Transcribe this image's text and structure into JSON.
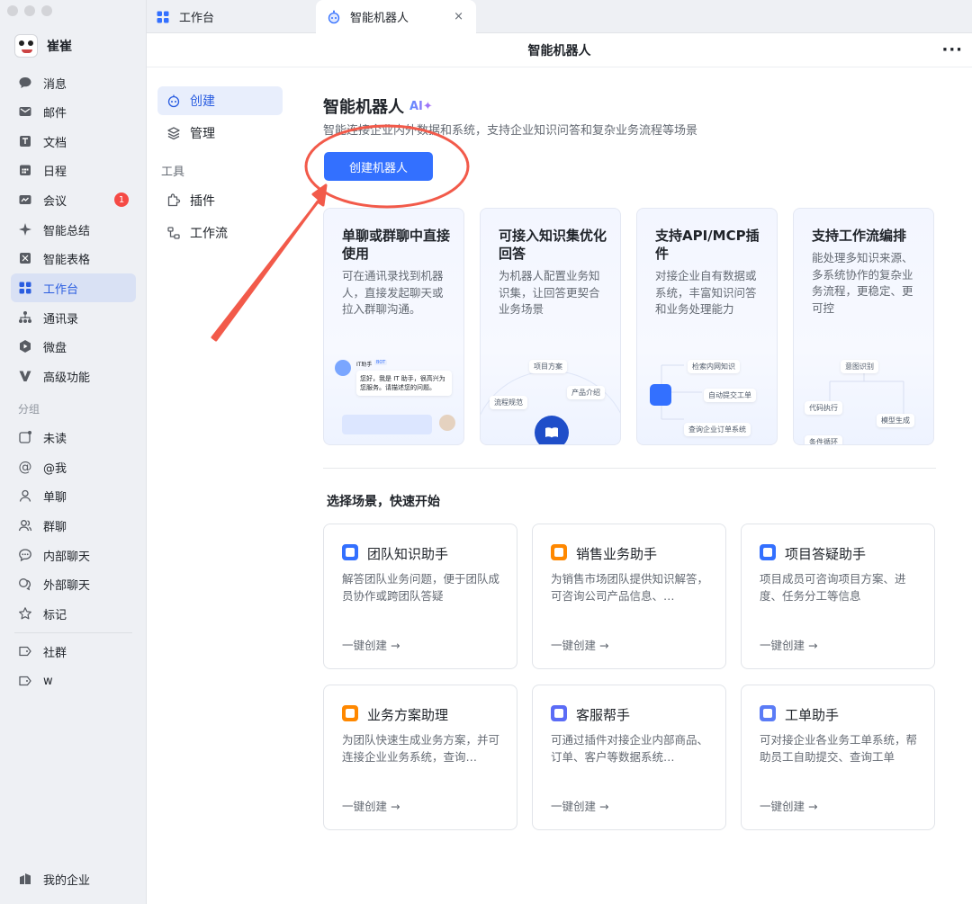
{
  "user": {
    "name": "崔崔"
  },
  "nav": {
    "items": [
      {
        "label": "消息",
        "icon": "message-icon"
      },
      {
        "label": "邮件",
        "icon": "mail-icon"
      },
      {
        "label": "文档",
        "icon": "document-icon"
      },
      {
        "label": "日程",
        "icon": "calendar-icon"
      },
      {
        "label": "会议",
        "icon": "meeting-icon",
        "badge": "1"
      },
      {
        "label": "智能总结",
        "icon": "sparkle-icon"
      },
      {
        "label": "智能表格",
        "icon": "table-icon"
      },
      {
        "label": "工作台",
        "icon": "workbench-icon",
        "active": true
      },
      {
        "label": "通讯录",
        "icon": "contacts-icon"
      },
      {
        "label": "微盘",
        "icon": "drive-icon"
      },
      {
        "label": "高级功能",
        "icon": "advanced-icon"
      }
    ],
    "group_label": "分组",
    "groups": [
      {
        "label": "未读",
        "icon": "unread-icon"
      },
      {
        "label": "@我",
        "icon": "mention-icon"
      },
      {
        "label": "单聊",
        "icon": "single-chat-icon"
      },
      {
        "label": "群聊",
        "icon": "group-chat-icon"
      },
      {
        "label": "内部聊天",
        "icon": "internal-chat-icon"
      },
      {
        "label": "外部聊天",
        "icon": "external-chat-icon"
      },
      {
        "label": "标记",
        "icon": "star-icon"
      }
    ],
    "tags": [
      {
        "label": "社群",
        "icon": "tag-icon"
      },
      {
        "label": "w",
        "icon": "tag-icon"
      }
    ],
    "bottom": {
      "label": "我的企业",
      "icon": "enterprise-icon"
    }
  },
  "tabs": [
    {
      "label": "工作台"
    },
    {
      "label": "智能机器人",
      "close": "×"
    }
  ],
  "page_title": "智能机器人",
  "more": "···",
  "subnav": {
    "create": "创建",
    "manage": "管理",
    "tools_label": "工具",
    "plugins": "插件",
    "workflow": "工作流"
  },
  "hero": {
    "title": "智能机器人",
    "ai_tag": "AI✦",
    "subtitle": "智能连接企业内外数据和系统，支持企业知识问答和复杂业务流程等场景",
    "create_button": "创建机器人"
  },
  "features": [
    {
      "title": "单聊或群聊中直接使用",
      "desc": "可在通讯录找到机器人，直接发起聊天或拉入群聊沟通。",
      "bot_name": "IT助手",
      "bot_tag": "BOT",
      "bubble": "您好，我是 IT 助手，很高兴为您服务。请描述您的问题。"
    },
    {
      "title": "可接入知识集优化回答",
      "desc": "为机器人配置业务知识集，让回答更契合业务场景",
      "chips": [
        "项目方案",
        "产品介绍",
        "流程规范"
      ]
    },
    {
      "title": "支持API/MCP插件",
      "desc": "对接企业自有数据或系统，丰富知识问答和业务处理能力",
      "chips": [
        "检索内网知识",
        "自动提交工单",
        "查询企业订单系统"
      ]
    },
    {
      "title": "支持工作流编排",
      "desc": "能处理多知识来源、多系统协作的复杂业务流程，更稳定、更可控",
      "chips": [
        "意图识别",
        "代码执行",
        "模型生成",
        "条件循环"
      ]
    }
  ],
  "scenes_title": "选择场景，快速开始",
  "scenes": [
    {
      "title": "团队知识助手",
      "desc": "解答团队业务问题，便于团队成员协作或跨团队答疑",
      "link": "一键创建 →",
      "color": "#3370ff"
    },
    {
      "title": "销售业务助手",
      "desc": "为销售市场团队提供知识解答，可咨询公司产品信息、…",
      "link": "一键创建 →",
      "color": "#ff8800"
    },
    {
      "title": "项目答疑助手",
      "desc": "项目成员可咨询项目方案、进度、任务分工等信息",
      "link": "一键创建 →",
      "color": "#3370ff"
    },
    {
      "title": "业务方案助理",
      "desc": "为团队快速生成业务方案，并可连接企业业务系统，查询…",
      "link": "一键创建 →",
      "color": "#ff8800"
    },
    {
      "title": "客服帮手",
      "desc": "可通过插件对接企业内部商品、订单、客户等数据系统…",
      "link": "一键创建 →",
      "color": "#5b6cf6"
    },
    {
      "title": "工单助手",
      "desc": "可对接企业各业务工单系统，帮助员工自助提交、查询工单",
      "link": "一键创建 →",
      "color": "#5b7cf6"
    }
  ],
  "annotation": {
    "color": "#f25a4a"
  }
}
